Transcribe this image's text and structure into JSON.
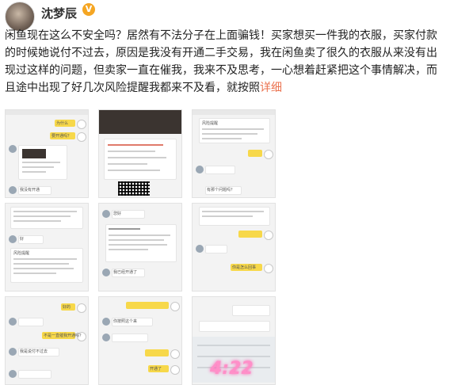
{
  "user": {
    "name": "沈梦辰",
    "verified_badge": "V"
  },
  "post": {
    "text": "闲鱼现在这么不安全吗？居然有不法分子在上面骗钱！买家想买一件我的衣服，买家付款的时候她说付不过去，原因是我没有开通二手交易，我在闲鱼卖了很久的衣服从来没有出现过这样的问题，但卖家一直在催我，我来不及思考，一心想着赶紧把这个事情解决，而且途中出现了好几次风险提醒我都来不及看，就按照",
    "more_link": "详细"
  },
  "images": {
    "count": 9,
    "tile_texts": [
      "为什么",
      "要开通吗？",
      "我没有开通",
      "风险提醒",
      "我已经开通了",
      "风险提醒",
      "有那个问题吗？",
      "好",
      "您好",
      "你是怎么回事",
      "好的",
      "开通了",
      "不是一直催我开通吗？",
      "你按照这个来",
      "我是说付不过去"
    ],
    "overlay_text": "4:22"
  },
  "colors": {
    "accent_more": "#eb7350",
    "badge": "#f5a623",
    "bubble": "#f7d84a",
    "overlay": "#ff8fc8"
  }
}
